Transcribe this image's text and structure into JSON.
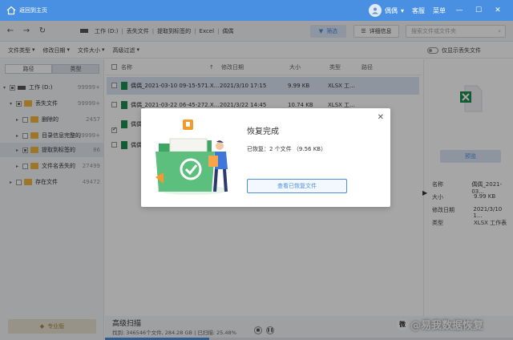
{
  "titlebar": {
    "home_label": "返回到主页",
    "user_name": "偶偶",
    "support": "客服",
    "menu": "菜单"
  },
  "navbar": {
    "crumbs": [
      "工作 (D:)",
      "丢失文件",
      "提取到标签的",
      "Excel",
      "偶偶"
    ],
    "filter_label": "筛选",
    "detail_label": "详细信息",
    "search_placeholder": "搜索文件或文件夹"
  },
  "toolbar": {
    "file_type": "文件类型",
    "modified_date": "修改日期",
    "file_size": "文件大小",
    "advanced_filter": "高级过滤",
    "show_lost_only": "仅显示丢失文件"
  },
  "sidebar": {
    "tab_path": "路径",
    "tab_type": "类型",
    "tree": [
      {
        "label": "工作 (D:)",
        "count": "99999+"
      },
      {
        "label": "丢失文件",
        "count": "99999+"
      },
      {
        "label": "删除的",
        "count": "2457"
      },
      {
        "label": "目录信息完整的",
        "count": "99999+"
      },
      {
        "label": "提取到标签的",
        "count": "86"
      },
      {
        "label": "文件名丢失的",
        "count": "27499"
      },
      {
        "label": "存在文件",
        "count": "49472"
      }
    ],
    "pro_label": "专业版"
  },
  "list": {
    "headers": {
      "name": "名称",
      "modified": "修改日期",
      "size": "大小",
      "type": "类型",
      "path": "路径"
    },
    "rows": [
      {
        "name": "偶偶_2021-03-10 09-15-571.X...",
        "modified": "2021/3/10 17:15",
        "size": "9.99 KB",
        "type": "XLSX 工..."
      },
      {
        "name": "偶偶_2021-03-22 06-45-272.X...",
        "modified": "2021/3/22 14:45",
        "size": "10.74 KB",
        "type": "XLSX 工..."
      },
      {
        "name": "偶偶",
        "modified": "",
        "size": "",
        "type": ""
      },
      {
        "name": "偶偶",
        "modified": "",
        "size": "",
        "type": ""
      }
    ]
  },
  "preview": {
    "button": "预览",
    "name_k": "名称",
    "name_v": "偶偶_2021-03...",
    "size_k": "大小",
    "size_v": "9.99 KB",
    "mod_k": "修改日期",
    "mod_v": "2021/3/10 1...",
    "type_k": "类型",
    "type_v": "XLSX 工作表"
  },
  "scan": {
    "title": "高级扫描",
    "info": "找到: 346546个文件, 284.28 GB | 已扫描: 25.48%",
    "progress": 0.2548
  },
  "dialog": {
    "title": "恢复完成",
    "text": "已恢复：2 个文件 （9.56 KB）",
    "button": "查看已恢复文件"
  },
  "watermark": "@易我数据恢复"
}
